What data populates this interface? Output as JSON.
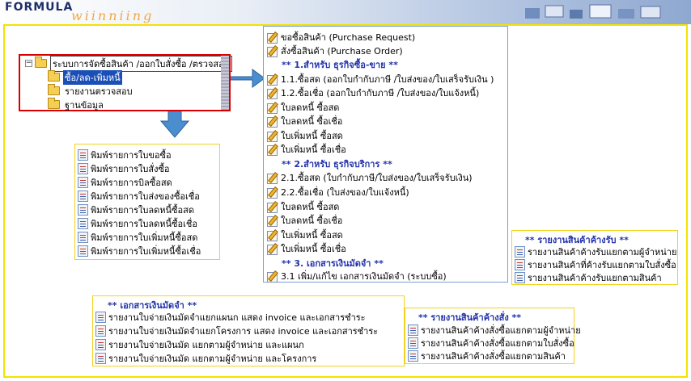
{
  "brand": {
    "line1": "FORMULA",
    "line2": "wiinniing"
  },
  "tree": {
    "root": "ระบบการจัดซื้อสินค้า /ออกใบสั่งซื้อ /ตรวจสอบ",
    "items": [
      {
        "label": "ซื้อ/ลด-เพิ่มหนี้",
        "selected": true
      },
      {
        "label": "รายงานตรวจสอบ",
        "selected": false
      },
      {
        "label": "ฐานข้อมูล",
        "selected": false
      }
    ]
  },
  "main_menu": {
    "top_items": [
      "ขอซื้อสินค้า (Purchase Request)",
      "สั่งซื้อสินค้า (Purchase Order)"
    ],
    "section1": {
      "title": "** 1.สำหรับ ธุรกิจซื้อ-ขาย **",
      "items": [
        "1.1.ซื้อสด (ออกใบกำกับภาษี /ใบส่งของ/ใบเสร็จรับเงิน )",
        "1.2.ซื้อเชื่อ (ออกใบกำกับภาษี /ใบส่งของ/ใบแจ้งหนี้)",
        "ใบลดหนี้ ซื้อสด",
        "ใบลดหนี้ ซื้อเชื่อ",
        "ใบเพิ่มหนี้ ซื้อสด",
        "ใบเพิ่มหนี้ ซื้อเชื่อ"
      ]
    },
    "section2": {
      "title": "** 2.สำหรับ ธุรกิจบริการ **",
      "items": [
        "2.1.ซื้อสด (ใบกำกับภาษี/ใบส่งของ/ใบเสร็จรับเงิน)",
        "2.2.ซื้อเชื่อ (ใบส่งของ/ใบแจ้งหนี้)",
        "ใบลดหนี้ ซื้อสด",
        "ใบลดหนี้ ซื้อเชื่อ",
        "ใบเพิ่มหนี้ ซื้อสด",
        "ใบเพิ่มหนี้ ซื้อเชื่อ"
      ]
    },
    "section3": {
      "title": "** 3. เอกสารเงินมัดจำ **",
      "items": [
        "3.1 เพิ่ม/แก้ไข เอกสารเงินมัดจำ (ระบบซื้อ)"
      ]
    }
  },
  "print_reports": {
    "items": [
      "พิมพ์รายการใบขอซื้อ",
      "พิมพ์รายการใบสั่งซื้อ",
      "พิมพ์รายการบิลซื้อสด",
      "พิมพ์รายการใบส่งของซื้อเชื่อ",
      "พิมพ์รายการใบลดหนี้ซื้อสด",
      "พิมพ์รายการใบลดหนี้ซื้อเชื่อ",
      "พิมพ์รายการใบเพิ่มหนี้ซื้อสด",
      "พิมพ์รายการใบเพิ่มหนี้ซื้อเชื่อ"
    ]
  },
  "pending_receipt": {
    "title": "** รายงานสินค้าค้างรับ **",
    "items": [
      "รายงานสินค้าค้างรับแยกตามผู้จำหน่าย",
      "รายงานสินค้าที่ค้างรับแยกตามใบสั่งซื้อ",
      "รายงานสินค้าค้างรับแยกตามสินค้า"
    ]
  },
  "deposit_docs": {
    "title": "** เอกสารเงินมัดจำ **",
    "items": [
      "รายงานใบจ่ายเงินมัดจำแยกแผนก แสดง invoice และเอกสารชำระ",
      "รายงานใบจ่ายเงินมัดจำแยกโครงการ แสดง invoice และเอกสารชำระ",
      "รายงานใบจ่ายเงินมัด แยกตามผู้จำหน่าย และแผนก",
      "รายงานใบจ่ายเงินมัด แยกตามผู้จำหน่าย และโครงการ"
    ]
  },
  "pending_order": {
    "title": "** รายงานสินค้าค้างสั่ง **",
    "items": [
      "รายงานสินค้าค้างสั่งซื้อแยกตามผู้จำหน่าย",
      "รายงานสินค้าค้างสั่งซื้อแยกตามใบสั่งซื้อ",
      "รายงานสินค้าค้างสั่งซื้อแยกตามสินค้า"
    ]
  }
}
